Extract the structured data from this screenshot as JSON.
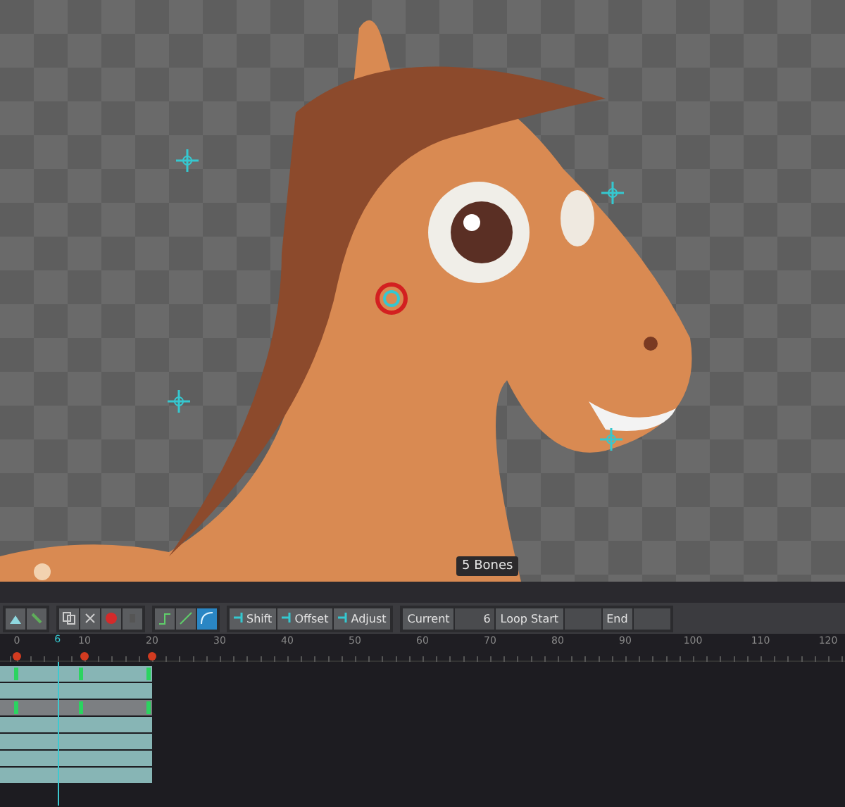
{
  "viewport": {
    "bone_count": "5 Bones"
  },
  "tool_buttons": [
    {
      "kind": "pose",
      "selected": false
    },
    {
      "kind": "bone",
      "selected": false
    },
    {
      "kind": "copy",
      "selected": false
    },
    {
      "kind": "cut",
      "selected": false
    },
    {
      "kind": "delete",
      "selected": false
    },
    {
      "kind": "lock",
      "selected": false
    },
    {
      "kind": "stepped",
      "selected": false
    },
    {
      "kind": "linear",
      "selected": false
    },
    {
      "kind": "bezier",
      "selected": true
    }
  ],
  "key_buttons": [
    {
      "label": "Shift"
    },
    {
      "label": "Offset"
    },
    {
      "label": "Adjust"
    }
  ],
  "frame_fields": [
    {
      "label": "Current",
      "value": "6"
    },
    {
      "label": "Loop Start"
    },
    {
      "label": "End"
    }
  ],
  "ruler": {
    "current_frame": "6",
    "labels": [
      {
        "text": "0",
        "key": true
      },
      {
        "text": "10",
        "key": true
      },
      {
        "text": "20",
        "key": true
      },
      {
        "text": "30",
        "key": false
      },
      {
        "text": "40",
        "key": false
      },
      {
        "text": "50",
        "key": false
      },
      {
        "text": "60",
        "key": false
      },
      {
        "text": "70",
        "key": false
      },
      {
        "text": "80",
        "key": false
      },
      {
        "text": "90",
        "key": false
      },
      {
        "text": "100",
        "key": false
      },
      {
        "text": "110",
        "key": false
      },
      {
        "text": "120",
        "key": false
      }
    ]
  },
  "timeline_rows": [
    {
      "selected": false,
      "keys": true
    },
    {
      "selected": false,
      "keys": false
    },
    {
      "selected": true,
      "keys": true
    },
    {
      "selected": false,
      "keys": false
    },
    {
      "selected": false,
      "keys": false
    },
    {
      "selected": false,
      "keys": false
    },
    {
      "selected": false,
      "keys": false
    }
  ]
}
